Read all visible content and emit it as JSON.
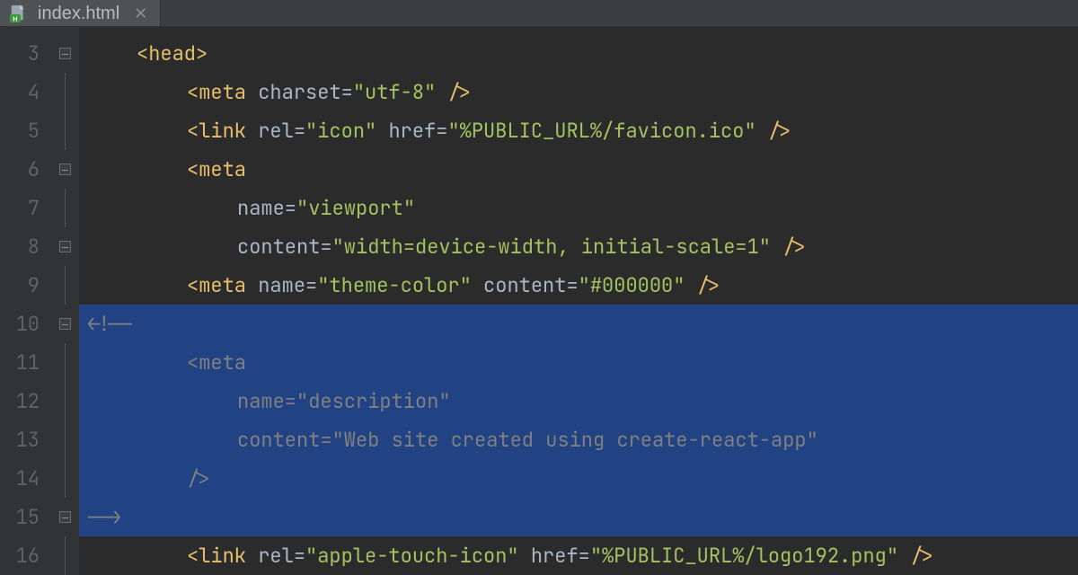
{
  "tab": {
    "filename": "index.html"
  },
  "gutter": {
    "start": 3,
    "end": 16
  },
  "code": {
    "l3": {
      "ind": 4,
      "sel": false,
      "fold": "box",
      "tokens": [
        [
          "t-punc",
          "<"
        ],
        [
          "t-tag",
          "head"
        ],
        [
          "t-punc",
          ">"
        ]
      ]
    },
    "l4": {
      "ind": 8,
      "sel": false,
      "fold": "line",
      "tokens": [
        [
          "t-punc",
          "<"
        ],
        [
          "t-tag",
          "meta "
        ],
        [
          "t-attr",
          "charset="
        ],
        [
          "t-str",
          "\"utf-8\" "
        ],
        [
          "t-punc",
          "/>"
        ]
      ]
    },
    "l5": {
      "ind": 8,
      "sel": false,
      "fold": "line",
      "tokens": [
        [
          "t-punc",
          "<"
        ],
        [
          "t-tag",
          "link "
        ],
        [
          "t-attr",
          "rel="
        ],
        [
          "t-str",
          "\"icon\" "
        ],
        [
          "t-attr",
          "href="
        ],
        [
          "t-str",
          "\"%PUBLIC_URL%/favicon.ico\" "
        ],
        [
          "t-punc",
          "/>"
        ]
      ]
    },
    "l6": {
      "ind": 8,
      "sel": false,
      "fold": "box",
      "tokens": [
        [
          "t-punc",
          "<"
        ],
        [
          "t-tag",
          "meta"
        ]
      ]
    },
    "l7": {
      "ind": 12,
      "sel": false,
      "fold": "line",
      "tokens": [
        [
          "t-attr",
          "name="
        ],
        [
          "t-str",
          "\"viewport\""
        ]
      ]
    },
    "l8": {
      "ind": 12,
      "sel": false,
      "fold": "boxend",
      "tokens": [
        [
          "t-attr",
          "content="
        ],
        [
          "t-str",
          "\"width=device-width, initial-scale=1\" "
        ],
        [
          "t-punc",
          "/>"
        ]
      ]
    },
    "l9": {
      "ind": 8,
      "sel": false,
      "fold": "line",
      "tokens": [
        [
          "t-punc",
          "<"
        ],
        [
          "t-tag",
          "meta "
        ],
        [
          "t-attr",
          "name="
        ],
        [
          "t-str",
          "\"theme-color\" "
        ],
        [
          "t-attr",
          "content="
        ],
        [
          "t-str",
          "\"#000000\" "
        ],
        [
          "t-punc",
          "/>"
        ]
      ]
    },
    "l10": {
      "ind": 0,
      "sel": true,
      "fold": "box",
      "tokens": [
        [
          "t-cmt",
          "<!--"
        ]
      ]
    },
    "l11": {
      "ind": 8,
      "sel": true,
      "fold": "line",
      "tokens": [
        [
          "t-cmt",
          "<meta"
        ]
      ]
    },
    "l12": {
      "ind": 12,
      "sel": true,
      "fold": "line",
      "tokens": [
        [
          "t-cmt",
          "name=\"description\""
        ]
      ]
    },
    "l13": {
      "ind": 12,
      "sel": true,
      "fold": "line",
      "tokens": [
        [
          "t-cmt",
          "content=\"Web site created using create-react-app\""
        ]
      ]
    },
    "l14": {
      "ind": 8,
      "sel": true,
      "fold": "line",
      "tokens": [
        [
          "t-cmt",
          "/>"
        ]
      ]
    },
    "l15": {
      "ind": 0,
      "sel": true,
      "fold": "boxend",
      "tokens": [
        [
          "t-cmt",
          "-->"
        ]
      ]
    },
    "l16": {
      "ind": 8,
      "sel": false,
      "fold": "line",
      "tokens": [
        [
          "t-punc",
          "<"
        ],
        [
          "t-tag",
          "link "
        ],
        [
          "t-attr",
          "rel="
        ],
        [
          "t-str",
          "\"apple-touch-icon\" "
        ],
        [
          "t-attr",
          "href="
        ],
        [
          "t-str",
          "\"%PUBLIC_URL%/logo192.png\" "
        ],
        [
          "t-punc",
          "/>"
        ]
      ]
    }
  }
}
